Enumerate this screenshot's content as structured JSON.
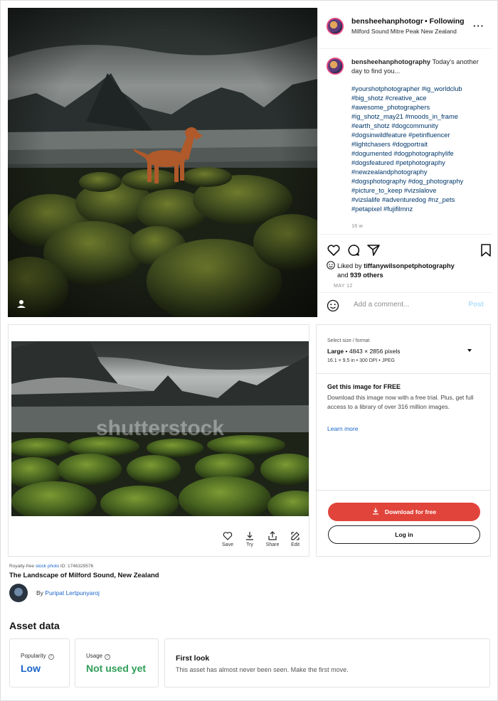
{
  "instagram": {
    "username": "bensheehanphotography",
    "username_truncated": "bensheehanphotogr",
    "follow_status": "• Following",
    "location": "Milford Sound Mitre Peak New Zealand",
    "more_label": "···",
    "caption_user": "bensheehanphotography",
    "caption_text": " Today's another day to find you...",
    "hashtag_lines": [
      "#yourshotphotographer #ig_worldclub",
      "#big_shotz #creative_ace",
      "#awesome_photographers",
      "#ig_shotz_may21 #moods_in_frame",
      "#earth_shotz #dogcommunity",
      "#dogsinwildfeature #petinfluencer",
      "#lightchasers #dogportrait",
      "#dogumented #dogphotographylife",
      "#dogsfeatured #petphotography",
      "#newzealandphotography",
      "#dogsphotography #dog_photography",
      "#picture_to_keep #vizslalove",
      "#vizslalife #adventuredog #nz_pets",
      "#petapixel #fujifilmnz"
    ],
    "age": "16 w",
    "liked_by_prefix": "Liked by ",
    "liked_by_user": "tiffanywilsonpetphotography",
    "liked_by_and": "and ",
    "liked_by_others": "939 others",
    "date": "MAY 12",
    "comment_placeholder": "Add a comment...",
    "post_label": "Post"
  },
  "shutterstock": {
    "watermark": "shutterstock",
    "tools": [
      {
        "label": "Save",
        "icon": "heart-icon"
      },
      {
        "label": "Try",
        "icon": "download-icon"
      },
      {
        "label": "Share",
        "icon": "share-icon"
      },
      {
        "label": "Edit",
        "icon": "edit-icon"
      }
    ],
    "size_label": "Select size / format",
    "size_name": "Large",
    "size_pixels": " • 4843 × 2856 pixels",
    "size_sub": "16.1 × 9.5 in • 300 DPI • JPEG",
    "free_title": "Get this image for FREE",
    "free_desc": "Download this image now with a free trial. Plus, get full access to a library of over 316 million images.",
    "learn_more": "Learn more",
    "download_button": "Download for free",
    "login_button": "Log in",
    "meta_prefix": "Royalty-free ",
    "meta_link": "stock photo",
    "meta_id": " ID: 1746329576",
    "asset_title": "The Landscape of Milford Sound, New Zealand",
    "by_label": "By ",
    "author": "Puripat Lertpunyaroj",
    "asset_data_heading": "Asset data",
    "popularity_label": "Popularity",
    "popularity_value": "Low",
    "usage_label": "Usage",
    "usage_value": "Not used yet",
    "first_look_title": "First look",
    "first_look_desc": "This asset has almost never been seen. Make the first move.",
    "colors": {
      "accent_red": "#e1443b",
      "link_blue": "#1a64c8",
      "popularity_blue": "#1a64c8",
      "usage_green": "#2e9e57"
    }
  }
}
